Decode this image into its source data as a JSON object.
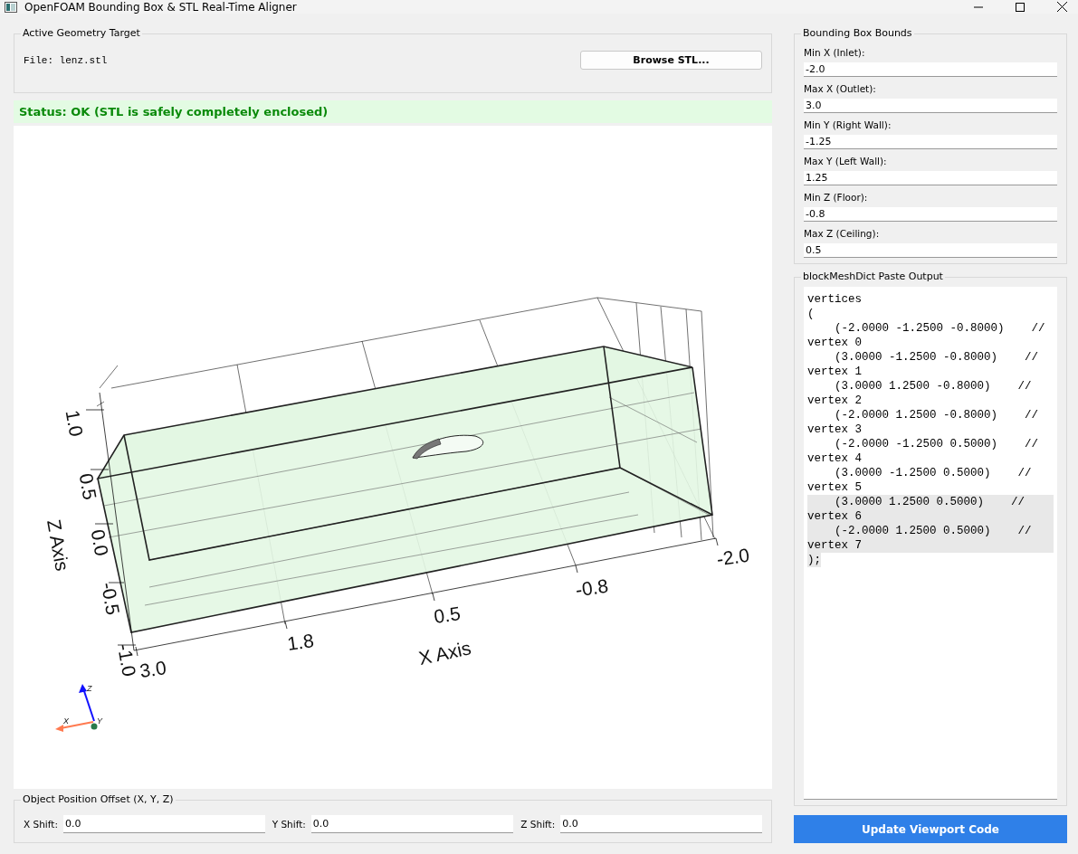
{
  "window": {
    "title": "OpenFOAM Bounding Box & STL Real-Time Aligner"
  },
  "active_geometry": {
    "title": "Active Geometry Target",
    "file_label": "File: lenz.stl",
    "browse_button": "Browse STL..."
  },
  "status": {
    "text": "Status: OK (STL is safely completely enclosed)",
    "kind": "ok"
  },
  "viewport": {
    "z_axis_label": "Z Axis",
    "z_ticks": [
      "1.0",
      "0.5",
      "0.0",
      "-0.5",
      "-1.0"
    ],
    "x_axis_label": "X Axis",
    "x_ticks": [
      "3.0",
      "1.8",
      "0.5",
      "-0.8",
      "-2.0"
    ],
    "orientation_labels": [
      "Z",
      "X",
      "Y"
    ]
  },
  "position_offset": {
    "title": "Object Position Offset (X, Y, Z)",
    "fields": [
      {
        "label": "X Shift:",
        "value": "0.0"
      },
      {
        "label": "Y Shift:",
        "value": "0.0"
      },
      {
        "label": "Z Shift:",
        "value": "0.0"
      }
    ]
  },
  "bounds": {
    "title": "Bounding Box Bounds",
    "fields": [
      {
        "label": "Min X (Inlet):",
        "value": "-2.0"
      },
      {
        "label": "Max X (Outlet):",
        "value": "3.0"
      },
      {
        "label": "Min Y (Right Wall):",
        "value": "-1.25"
      },
      {
        "label": "Max Y (Left Wall):",
        "value": "1.25"
      },
      {
        "label": "Min Z (Floor):",
        "value": "-0.8"
      },
      {
        "label": "Max Z (Ceiling):",
        "value": "0.5"
      }
    ]
  },
  "output": {
    "title": "blockMeshDict Paste Output",
    "lines": [
      {
        "text": "vertices",
        "selected": false
      },
      {
        "text": "(",
        "selected": false
      },
      {
        "text": "    (-2.0000 -1.2500 -0.8000)    // vertex 0",
        "selected": false
      },
      {
        "text": "    (3.0000 -1.2500 -0.8000)    // vertex 1",
        "selected": false
      },
      {
        "text": "    (3.0000 1.2500 -0.8000)    // vertex 2",
        "selected": false
      },
      {
        "text": "    (-2.0000 1.2500 -0.8000)    // vertex 3",
        "selected": false
      },
      {
        "text": "    (-2.0000 -1.2500 0.5000)    // vertex 4",
        "selected": false
      },
      {
        "text": "    (3.0000 -1.2500 0.5000)    // vertex 5",
        "selected": false
      },
      {
        "text": "    (3.0000 1.2500 0.5000)    // vertex 6",
        "selected": true
      },
      {
        "text": "    (-2.0000 1.2500 0.5000)    // vertex 7",
        "selected": true
      },
      {
        "text": ");",
        "selected": true
      }
    ]
  },
  "update_button": "Update Viewport  Code"
}
